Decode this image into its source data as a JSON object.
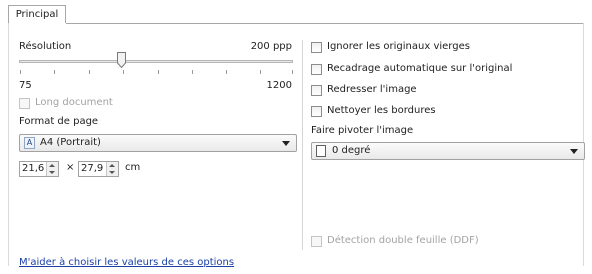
{
  "tabs": [
    {
      "label": "Principal"
    }
  ],
  "resolution": {
    "label": "Résolution",
    "value_text": "200 ppp",
    "min": "75",
    "max": "1200"
  },
  "long_document": {
    "label": "Long document"
  },
  "page_format": {
    "label": "Format de page",
    "selected": "A4 (Portrait)",
    "width": "21,6",
    "times": "×",
    "height": "27,9",
    "unit": "cm"
  },
  "options": [
    {
      "label": "Ignorer les originaux vierges"
    },
    {
      "label": "Recadrage automatique sur l'original"
    },
    {
      "label": "Redresser l'image"
    },
    {
      "label": "Nettoyer les bordures"
    }
  ],
  "rotate": {
    "label": "Faire pivoter l'image",
    "selected": "0 degré"
  },
  "ddf": {
    "label": "Détection double feuille (DDF)"
  },
  "help_link": "M'aider à choisir les valeurs de ces options"
}
